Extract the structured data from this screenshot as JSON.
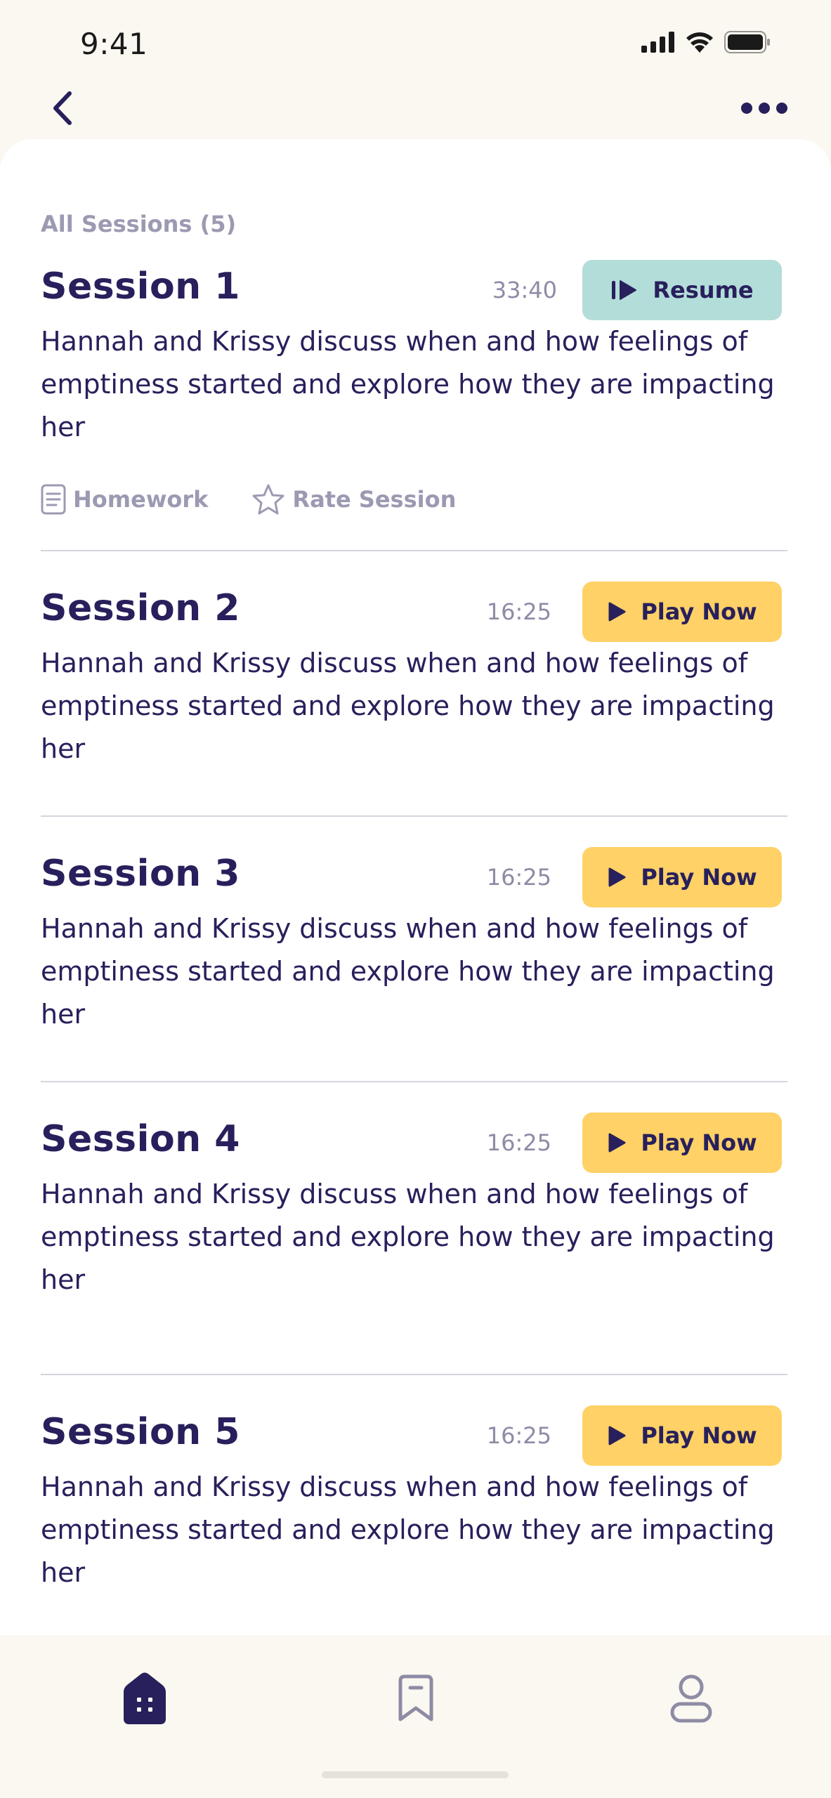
{
  "status_bar": {
    "time": "9:41"
  },
  "list": {
    "header": "All Sessions (5)",
    "sessions": [
      {
        "title": "Session 1",
        "duration": "33:40",
        "button_label": "Resume",
        "description": "Hannah and Krissy discuss when and how feelings of emptiness started and explore how they are impacting her",
        "homework_label": "Homework",
        "rate_label": "Rate Session"
      },
      {
        "title": "Session 2",
        "duration": "16:25",
        "button_label": "Play Now",
        "description": "Hannah and Krissy discuss when and how feelings of emptiness started and explore how they are impacting her"
      },
      {
        "title": "Session 3",
        "duration": "16:25",
        "button_label": "Play Now",
        "description": "Hannah and Krissy discuss when and how feelings of emptiness started and explore how they are impacting her"
      },
      {
        "title": "Session 4",
        "duration": "16:25",
        "button_label": "Play Now",
        "description": "Hannah and Krissy discuss when and how feelings of emptiness started and explore how they are impacting her"
      },
      {
        "title": "Session 5",
        "duration": "16:25",
        "button_label": "Play Now",
        "description": "Hannah and Krissy discuss when and how feelings of emptiness started and explore how they are impacting her"
      }
    ]
  },
  "tab_bar": {
    "tabs": [
      {
        "icon": "home-icon",
        "active": true
      },
      {
        "icon": "bookmark-icon",
        "active": false
      },
      {
        "icon": "profile-icon",
        "active": false
      }
    ]
  },
  "colors": {
    "primary": "#28205C",
    "background": "#FBF8F1",
    "resume_button": "#B3DDD9",
    "play_button": "#FFD166",
    "muted_text": "#9C9AB2"
  }
}
